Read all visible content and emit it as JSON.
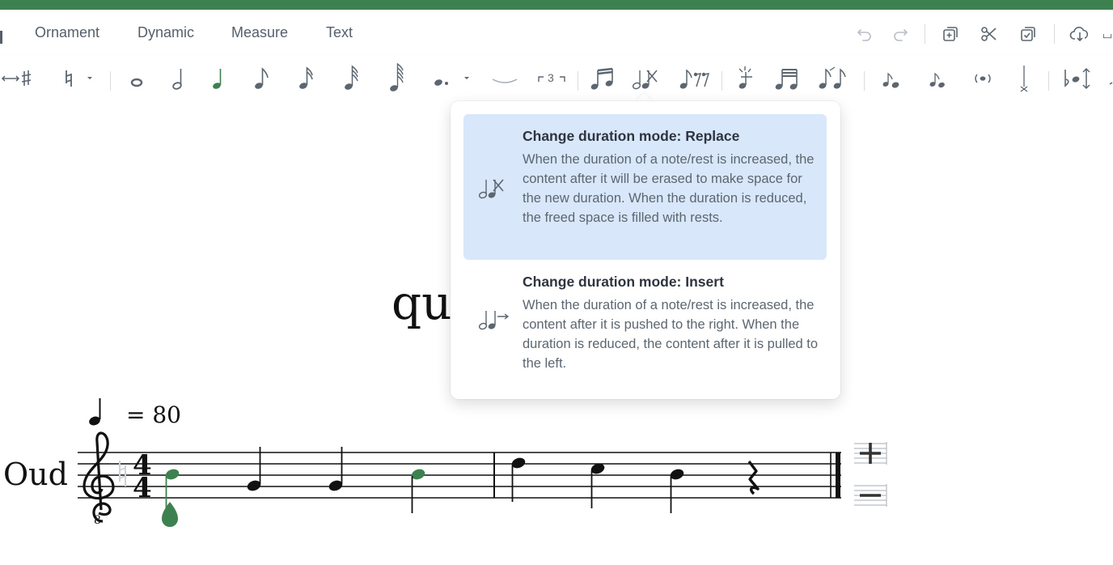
{
  "menu": {
    "items": [
      {
        "label": "Ornament"
      },
      {
        "label": "Dynamic"
      },
      {
        "label": "Measure"
      },
      {
        "label": "Text"
      }
    ]
  },
  "toolbar": {
    "tuplet_label": "3",
    "active_color": "#3e8150"
  },
  "score": {
    "title_fragment": "qu",
    "tempo": "= 80",
    "instrument": "Oud",
    "time_signature_top": "4",
    "time_signature_bottom": "4"
  },
  "duration_popup": {
    "options": [
      {
        "title": "Change duration mode: Replace",
        "desc": "When the duration of a note/rest is increased, the content after it will be erased to make space for the new duration. When the duration is reduced, the freed space is filled with rests.",
        "selected": true
      },
      {
        "title": "Change duration mode: Insert",
        "desc": "When the duration of a note/rest is increased, the content after it is pushed to the right. When the duration is reduced, the content after it is pulled to the left.",
        "selected": false
      }
    ]
  },
  "colors": {
    "brand": "#3e8150",
    "selection": "#d9e7fa",
    "text": "#2e3540",
    "muted": "#5c6670"
  }
}
